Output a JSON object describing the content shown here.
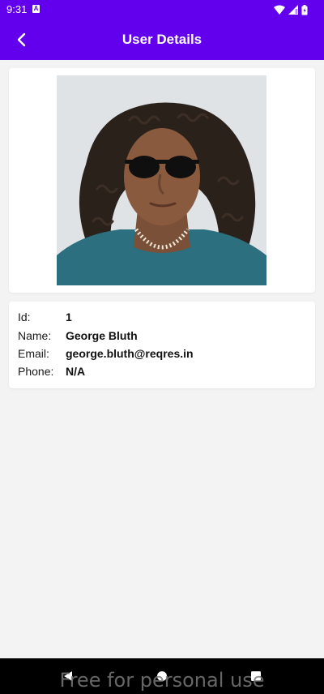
{
  "status_bar": {
    "time": "9:31",
    "notification_icon": "a-box-icon",
    "wifi_icon": "wifi-icon",
    "signal_icon": "signal-icon",
    "battery_icon": "battery-icon"
  },
  "app_bar": {
    "title": "User Details",
    "back_icon": "chevron-left-icon",
    "background": "#6200ee"
  },
  "user": {
    "photo_icon": "user-photo",
    "fields": [
      {
        "label": "Id:",
        "value": "1"
      },
      {
        "label": "Name:",
        "value": "George Bluth"
      },
      {
        "label": "Email:",
        "value": "george.bluth@reqres.in"
      },
      {
        "label": "Phone:",
        "value": "N/A"
      }
    ]
  },
  "nav_bar": {
    "back_icon": "triangle-back-icon",
    "home_icon": "circle-home-icon",
    "recents_icon": "square-recents-icon",
    "watermark": "Free for personal use"
  }
}
